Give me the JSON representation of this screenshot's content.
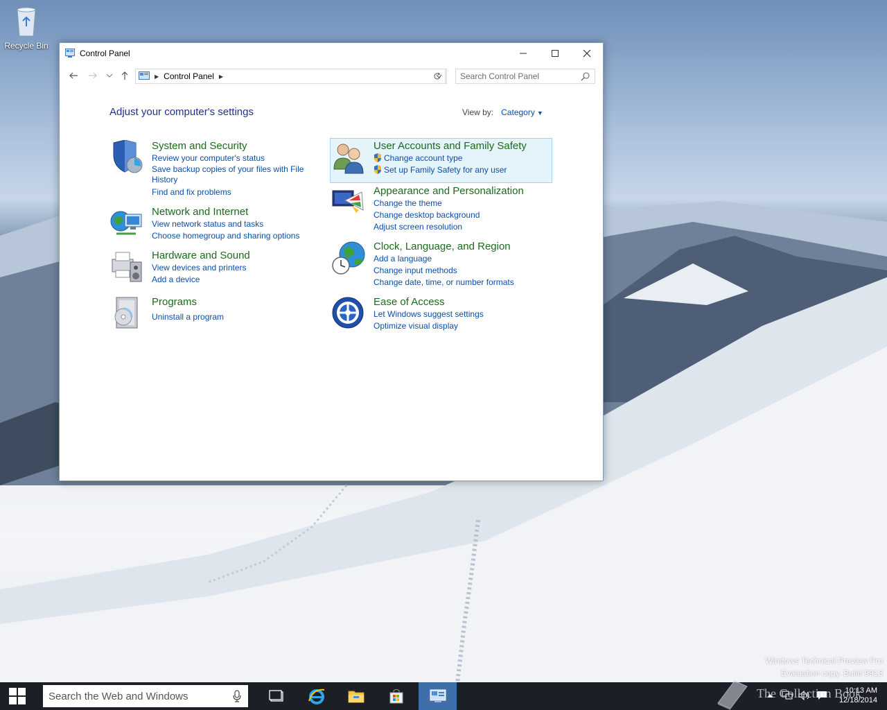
{
  "desktop": {
    "recycle_bin_label": "Recycle Bin",
    "watermark_line1": "Windows Technical Preview Pro",
    "watermark_line2": "Evaluation copy. Build 9913",
    "overlay_text": "The Collection Book"
  },
  "window": {
    "title": "Control Panel",
    "address": {
      "crumb": "Control Panel"
    },
    "search_placeholder": "Search Control Panel",
    "heading": "Adjust your computer's settings",
    "view_by": {
      "label": "View by:",
      "value": "Category"
    }
  },
  "categories": {
    "system_security": {
      "title": "System and Security",
      "links": [
        "Review your computer's status",
        "Save backup copies of your files with File History",
        "Find and fix problems"
      ]
    },
    "network": {
      "title": "Network and Internet",
      "links": [
        "View network status and tasks",
        "Choose homegroup and sharing options"
      ]
    },
    "hardware": {
      "title": "Hardware and Sound",
      "links": [
        "View devices and printers",
        "Add a device"
      ]
    },
    "programs": {
      "title": "Programs",
      "links": [
        "Uninstall a program"
      ]
    },
    "user_accounts": {
      "title": "User Accounts and Family Safety",
      "links": [
        "Change account type",
        "Set up Family Safety for any user"
      ]
    },
    "appearance": {
      "title": "Appearance and Personalization",
      "links": [
        "Change the theme",
        "Change desktop background",
        "Adjust screen resolution"
      ]
    },
    "clock": {
      "title": "Clock, Language, and Region",
      "links": [
        "Add a language",
        "Change input methods",
        "Change date, time, or number formats"
      ]
    },
    "ease": {
      "title": "Ease of Access",
      "links": [
        "Let Windows suggest settings",
        "Optimize visual display"
      ]
    }
  },
  "taskbar": {
    "search_placeholder": "Search the Web and Windows",
    "clock_time": "10:13 AM",
    "clock_date": "12/18/2014"
  },
  "colors": {
    "link": "#0b4ea8",
    "category_title": "#1a6b1a",
    "heading": "#1e3287",
    "taskbar": "#1c1f26",
    "active_taskbar_item": "#3f6fa8",
    "highlight": "#e5f3fb"
  }
}
